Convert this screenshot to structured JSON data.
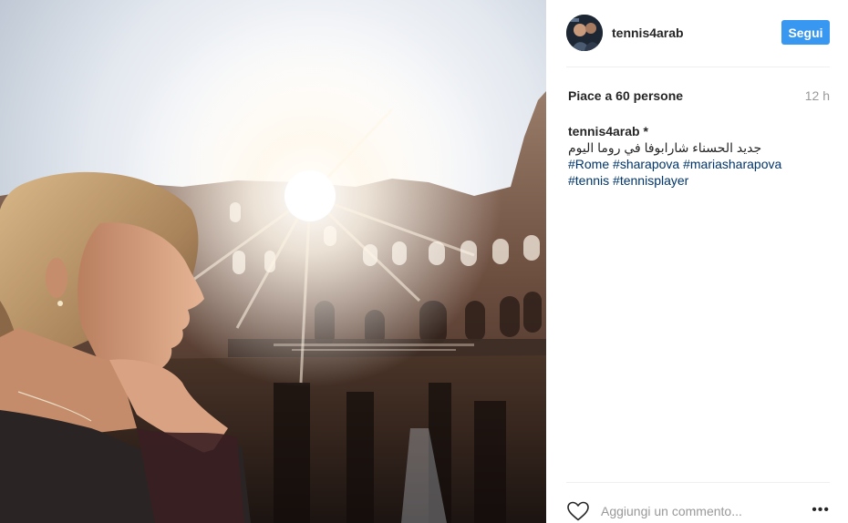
{
  "post": {
    "photo_icon": "photo-colosseum",
    "header": {
      "username": "tennis4arab",
      "follow_label": "Segui",
      "accent_color": "#3897f0"
    },
    "likes_text": "Piace a 60 persone",
    "time_ago": "12 h",
    "caption": {
      "username": "tennis4arab *",
      "text_arabic": "جديد الحسناء شارابوفا في روما اليوم",
      "hashtags": [
        "#Rome",
        "#sharapova",
        "#mariasharapova",
        "#tennis",
        "#tennisplayer"
      ]
    },
    "comment": {
      "placeholder": "Aggiungi un commento...",
      "more_label": "•••"
    }
  }
}
